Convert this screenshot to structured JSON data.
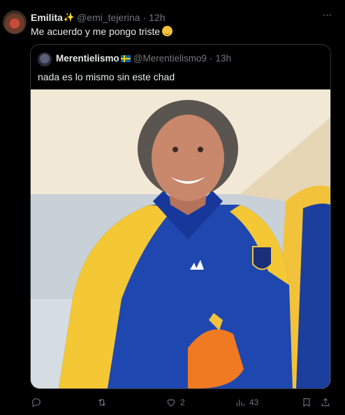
{
  "tweet": {
    "author_name": "Emilita",
    "author_handle": "@emi_tejerina",
    "time": "12h",
    "text": "Me acuerdo y me pongo triste"
  },
  "quote": {
    "author_name": "Merentielismo",
    "author_handle": "@Merentielismo9",
    "time": "13h",
    "text": "nada es lo mismo sin este chad"
  },
  "actions": {
    "reply_count": "",
    "retweet_count": "",
    "like_count": "2",
    "views_count": "43"
  },
  "icons": [
    "more-icon",
    "sparkles-icon",
    "relieved-face-icon",
    "sweden-flag-icon",
    "reply-icon",
    "retweet-icon",
    "like-icon",
    "views-icon",
    "bookmark-icon",
    "share-icon"
  ],
  "colors": {
    "background": "#000000",
    "text": "#e7e9ea",
    "secondary": "#71767b",
    "border": "#2f3336"
  }
}
